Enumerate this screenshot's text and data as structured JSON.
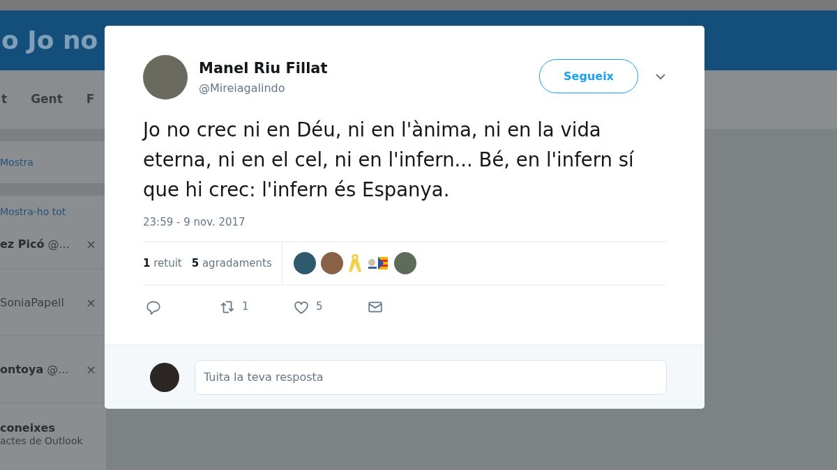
{
  "background": {
    "header_title": "o Jo no",
    "tabs": [
      {
        "label": "t"
      },
      {
        "label": "Gent"
      },
      {
        "label": "F"
      }
    ],
    "show_link": "Mostra",
    "show_all_link": "Mostra-ho tot",
    "suggestions": [
      {
        "name": "ez Picó",
        "handle": "@...",
        "close": "×"
      },
      {
        "handle": "SoniaPapell",
        "close": "×"
      },
      {
        "name": "ontoya",
        "handle": "@...",
        "close": "×"
      }
    ],
    "footer_title": "coneixes",
    "footer_text": "actes de Outlook"
  },
  "tweet": {
    "author": "Manel Riu Fillat",
    "handle": "@Mireiagalindo",
    "follow_button": "Segueix",
    "text": "Jo no crec ni en Déu, ni en l'ànima, ni en la vida eterna, ni en el cel, ni en l'infern... Bé, en l'infern sí que hi crec: l'infern és Espanya.",
    "timestamp": "23:59 - 9 nov. 2017",
    "stats": [
      {
        "count": "1",
        "label": "retuit"
      },
      {
        "count": "5",
        "label": "agradaments"
      }
    ],
    "likers": [
      {
        "kind": "photo",
        "color": "#2f5a6e"
      },
      {
        "kind": "photo",
        "color": "#8a6248"
      },
      {
        "kind": "ribbon"
      },
      {
        "kind": "flags"
      },
      {
        "kind": "photo",
        "color": "#5d6b5a"
      }
    ],
    "actions": [
      {
        "kind": "reply"
      },
      {
        "kind": "retweet",
        "count": "1"
      },
      {
        "kind": "like",
        "count": "5"
      },
      {
        "kind": "message"
      }
    ],
    "reply_placeholder": "Tuita la teva resposta"
  }
}
